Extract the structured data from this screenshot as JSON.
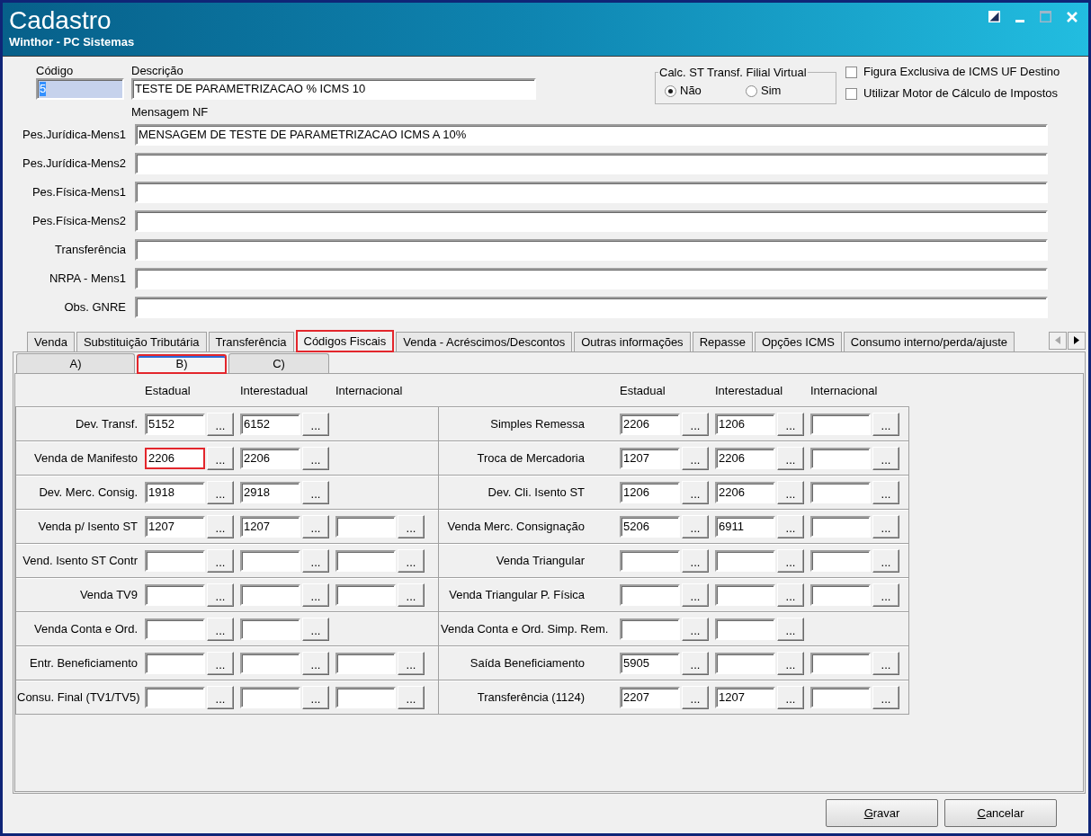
{
  "window": {
    "title": "Cadastro",
    "subtitle": "Winthor - PC Sistemas"
  },
  "header": {
    "code": {
      "label": "Código",
      "value": "5",
      "value_selected": true
    },
    "description": {
      "label": "Descrição",
      "value": "TESTE DE PARAMETRIZACAO % ICMS 10"
    },
    "calc_st_group": {
      "title": "Calc. ST Transf. Filial Virtual",
      "options": [
        {
          "label": "Não",
          "selected": true
        },
        {
          "label": "Sim",
          "selected": false
        }
      ]
    },
    "checkboxes": [
      {
        "label": "Figura Exclusiva de ICMS UF Destino",
        "checked": false
      },
      {
        "label": "Utilizar Motor de Cálculo de Impostos",
        "checked": false
      }
    ]
  },
  "messages": {
    "title": "Mensagem NF",
    "rows": [
      {
        "label": "Pes.Jurídica-Mens1",
        "value": "MENSAGEM DE TESTE DE PARAMETRIZACAO ICMS A 10%"
      },
      {
        "label": "Pes.Jurídica-Mens2"
      },
      {
        "label": "Pes.Física-Mens1"
      },
      {
        "label": "Pes.Física-Mens2"
      },
      {
        "label": "Transferência"
      },
      {
        "label": "NRPA - Mens1"
      },
      {
        "label": "Obs. GNRE"
      }
    ]
  },
  "tabs": [
    {
      "label": "Venda",
      "selected": false,
      "highlighted": false
    },
    {
      "label": "Substituição Tributária",
      "selected": false,
      "highlighted": false
    },
    {
      "label": "Transferência",
      "selected": false,
      "highlighted": false
    },
    {
      "label": "Códigos Fiscais",
      "selected": true,
      "highlighted": true
    },
    {
      "label": "Venda - Acréscimos/Descontos",
      "selected": false,
      "highlighted": false
    },
    {
      "label": "Outras informações",
      "selected": false,
      "highlighted": false
    },
    {
      "label": "Repasse",
      "selected": false,
      "highlighted": false
    },
    {
      "label": "Opções ICMS",
      "selected": false,
      "highlighted": false
    },
    {
      "label": "Consumo interno/perda/ajuste",
      "selected": false,
      "highlighted": false
    }
  ],
  "tab_scroll": [
    {
      "kind": "left",
      "disabled": true
    },
    {
      "kind": "right",
      "disabled": false
    }
  ],
  "subtabs": [
    {
      "label": "A)",
      "selected": false,
      "highlighted": false
    },
    {
      "label": "B)",
      "selected": true,
      "highlighted": true
    },
    {
      "label": "C)",
      "selected": false,
      "highlighted": false
    }
  ],
  "panels": [
    {
      "columns": [
        "Estadual",
        "Interestadual",
        "Internacional"
      ],
      "rows": [
        {
          "label": "Dev. Transf.",
          "fields": [
            {
              "value": "5152",
              "button": "...",
              "highlighted": false
            },
            {
              "value": "6152",
              "button": "...",
              "highlighted": false
            }
          ]
        },
        {
          "label": "Venda de Manifesto",
          "fields": [
            {
              "value": "2206",
              "button": "...",
              "highlighted": true
            },
            {
              "value": "2206",
              "button": "...",
              "highlighted": false
            }
          ]
        },
        {
          "label": "Dev. Merc. Consig.",
          "fields": [
            {
              "value": "1918",
              "button": "...",
              "highlighted": false
            },
            {
              "value": "2918",
              "button": "...",
              "highlighted": false
            }
          ]
        },
        {
          "label": "Venda p/ Isento ST",
          "fields": [
            {
              "value": "1207",
              "button": "...",
              "highlighted": false
            },
            {
              "value": "1207",
              "button": "...",
              "highlighted": false
            },
            {
              "button": "...",
              "highlighted": false
            }
          ]
        },
        {
          "label": "Vend. Isento ST Contr",
          "fields": [
            {
              "button": "...",
              "highlighted": false
            },
            {
              "button": "...",
              "highlighted": false
            },
            {
              "button": "...",
              "highlighted": false
            }
          ]
        },
        {
          "label": "Venda TV9",
          "fields": [
            {
              "button": "...",
              "highlighted": false
            },
            {
              "button": "...",
              "highlighted": false
            },
            {
              "button": "...",
              "highlighted": false
            }
          ]
        },
        {
          "label": "Venda Conta e Ord.",
          "fields": [
            {
              "button": "...",
              "highlighted": false
            },
            {
              "button": "...",
              "highlighted": false
            }
          ]
        },
        {
          "label": "Entr. Beneficiamento",
          "fields": [
            {
              "button": "...",
              "highlighted": false
            },
            {
              "button": "...",
              "highlighted": false
            },
            {
              "button": "...",
              "highlighted": false
            }
          ]
        },
        {
          "label": "Consu. Final (TV1/TV5)",
          "fields": [
            {
              "button": "...",
              "highlighted": false
            },
            {
              "button": "...",
              "highlighted": false
            },
            {
              "button": "...",
              "highlighted": false
            }
          ]
        }
      ]
    },
    {
      "columns": [
        "Estadual",
        "Interestadual",
        "Internacional"
      ],
      "rows": [
        {
          "label": "Simples Remessa",
          "fields": [
            {
              "value": "2206",
              "button": "...",
              "highlighted": false
            },
            {
              "value": "1206",
              "button": "...",
              "highlighted": false
            },
            {
              "button": "...",
              "highlighted": false
            }
          ]
        },
        {
          "label": "Troca de Mercadoria",
          "fields": [
            {
              "value": "1207",
              "button": "...",
              "highlighted": false
            },
            {
              "value": "2206",
              "button": "...",
              "highlighted": false
            },
            {
              "button": "...",
              "highlighted": false
            }
          ]
        },
        {
          "label": "Dev. Cli. Isento ST",
          "fields": [
            {
              "value": "1206",
              "button": "...",
              "highlighted": false
            },
            {
              "value": "2206",
              "button": "...",
              "highlighted": false
            },
            {
              "button": "...",
              "highlighted": false
            }
          ]
        },
        {
          "label": "Venda Merc. Consignação",
          "fields": [
            {
              "value": "5206",
              "button": "...",
              "highlighted": false
            },
            {
              "value": "6911",
              "button": "...",
              "highlighted": false
            },
            {
              "button": "...",
              "highlighted": false
            }
          ]
        },
        {
          "label": "Venda Triangular",
          "fields": [
            {
              "button": "...",
              "highlighted": false
            },
            {
              "button": "...",
              "highlighted": false
            },
            {
              "button": "...",
              "highlighted": false
            }
          ]
        },
        {
          "label": "Venda Triangular P. Física",
          "fields": [
            {
              "button": "...",
              "highlighted": false
            },
            {
              "button": "...",
              "highlighted": false
            },
            {
              "button": "...",
              "highlighted": false
            }
          ]
        },
        {
          "label": "Venda Conta e Ord. Simp. Rem.",
          "fields": [
            {
              "button": "...",
              "highlighted": false
            },
            {
              "button": "...",
              "highlighted": false
            }
          ]
        },
        {
          "label": "Saída Beneficiamento",
          "fields": [
            {
              "value": "5905",
              "button": "...",
              "highlighted": false
            },
            {
              "button": "...",
              "highlighted": false
            },
            {
              "button": "...",
              "highlighted": false
            }
          ]
        },
        {
          "label": "Transferência (1124)",
          "fields": [
            {
              "value": "2207",
              "button": "...",
              "highlighted": false
            },
            {
              "value": "1207",
              "button": "...",
              "highlighted": false
            },
            {
              "button": "...",
              "highlighted": false
            }
          ]
        }
      ]
    }
  ],
  "buttons": [
    {
      "label": "Gravar"
    },
    {
      "label": "Cancelar"
    }
  ]
}
